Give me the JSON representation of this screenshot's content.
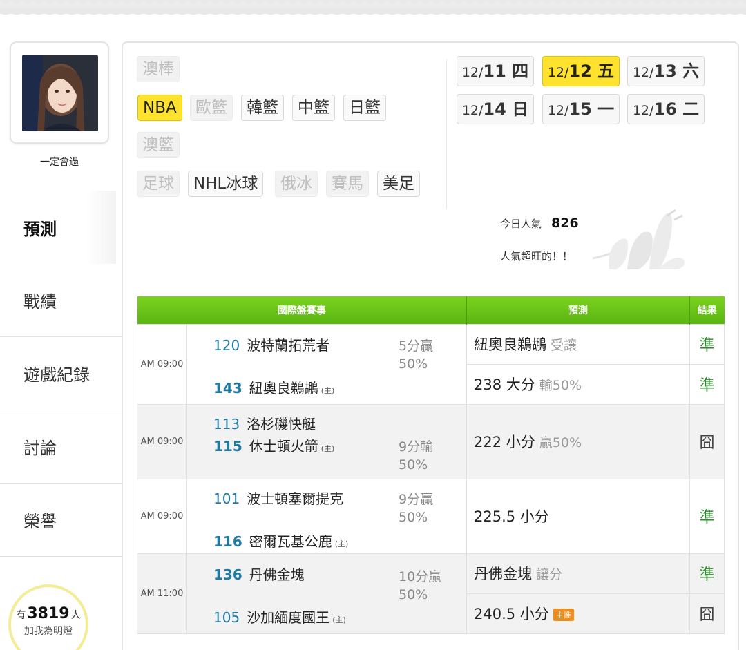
{
  "profile": {
    "username": "一定會過"
  },
  "sidebar": {
    "items": [
      {
        "label": "預測"
      },
      {
        "label": "戰績"
      },
      {
        "label": "遊戲紀錄"
      },
      {
        "label": "討論"
      },
      {
        "label": "榮譽"
      }
    ],
    "fans": {
      "prefix": "有",
      "count": "3819",
      "suffix": "人",
      "cta": "加我為明燈"
    }
  },
  "sports": {
    "row1": [
      {
        "label": "澳棒",
        "state": "disabled"
      }
    ],
    "row2": [
      {
        "label": "NBA",
        "state": "active"
      },
      {
        "label": "歐籃",
        "state": "disabled"
      },
      {
        "label": "韓籃",
        "state": "normal"
      },
      {
        "label": "中籃",
        "state": "normal"
      },
      {
        "label": "日籃",
        "state": "normal"
      }
    ],
    "row3": [
      {
        "label": "澳籃",
        "state": "disabled"
      }
    ],
    "row4": [
      {
        "label": "足球",
        "state": "disabled"
      },
      {
        "label": "NHL冰球",
        "state": "normal"
      },
      {
        "label": "俄冰",
        "state": "disabled"
      },
      {
        "label": "賽馬",
        "state": "disabled"
      },
      {
        "label": "美足",
        "state": "normal"
      }
    ]
  },
  "dates": [
    {
      "md": "12/",
      "d": "11",
      "wd": " 四",
      "active": false
    },
    {
      "md": "12/",
      "d": "12",
      "wd": " 五",
      "active": true
    },
    {
      "md": "12/",
      "d": "13",
      "wd": " 六",
      "active": false
    },
    {
      "md": "12/",
      "d": "14",
      "wd": " 日",
      "active": false
    },
    {
      "md": "12/",
      "d": "15",
      "wd": " 一",
      "active": false
    },
    {
      "md": "12/",
      "d": "16",
      "wd": " 二",
      "active": false
    }
  ],
  "popularity": {
    "label": "今日人氣",
    "value": "826",
    "note": "人氣超旺的！！"
  },
  "table": {
    "headers": {
      "match": "國際盤賽事",
      "prediction": "預測",
      "result": "結果"
    },
    "rows": [
      {
        "time": "AM 09:00",
        "away": {
          "num": "120",
          "name": "波特蘭拓荒者"
        },
        "home": {
          "num": "143",
          "name": "紐奧良鵜鶘",
          "tag": "(主)"
        },
        "line": {
          "spread": "5分贏",
          "pct": "50%"
        },
        "preds": [
          {
            "text": "紐奧良鵜鶘",
            "sub": "受讓",
            "result": "準",
            "badge": ""
          },
          {
            "text": "238 大分",
            "sub": "輸50%",
            "result": "準",
            "badge": ""
          }
        ]
      },
      {
        "time": "AM 09:00",
        "away": {
          "num": "113",
          "name": "洛杉磯快艇"
        },
        "home": {
          "num": "115",
          "name": "休士頓火箭",
          "tag": "(主)"
        },
        "line": {
          "spread": "9分輸",
          "pct": "50%"
        },
        "preds": [
          {
            "text": "222 小分",
            "sub": "贏50%",
            "result": "囧",
            "badge": ""
          }
        ]
      },
      {
        "time": "AM 09:00",
        "away": {
          "num": "101",
          "name": "波士頓塞爾提克"
        },
        "home": {
          "num": "116",
          "name": "密爾瓦基公鹿",
          "tag": "(主)"
        },
        "line": {
          "spread": "9分贏",
          "pct": "50%"
        },
        "preds": [
          {
            "text": "225.5 小分",
            "sub": "",
            "result": "準",
            "badge": ""
          }
        ]
      },
      {
        "time": "AM 11:00",
        "away": {
          "num": "136",
          "name": "丹佛金塊"
        },
        "home": {
          "num": "105",
          "name": "沙加緬度國王",
          "tag": "(主)"
        },
        "line": {
          "spread": "10分贏",
          "pct": "50%"
        },
        "preds": [
          {
            "text": "丹佛金塊",
            "sub": "讓分",
            "result": "準",
            "badge": ""
          },
          {
            "text": "240.5 小分",
            "sub": "",
            "result": "囧",
            "badge": "主推"
          }
        ]
      }
    ]
  },
  "colors": {
    "accent": "#ffe22e",
    "header_green": "#6cc417",
    "win": "#2e8b2e"
  }
}
